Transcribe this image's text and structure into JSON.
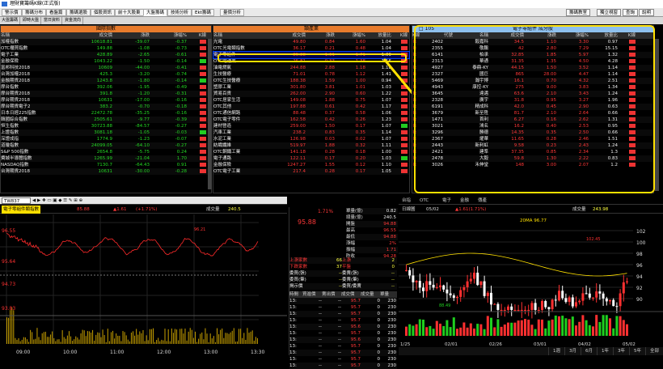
{
  "window": {
    "title": "理財寶籌碼K線(正式版)"
  },
  "tabs": [
    "警示價",
    "籌碼分布",
    "看盤篇",
    "籌碼選股",
    "個股資訊",
    "前十大股東",
    "大盤籌碼",
    "技術分析",
    "Ekt籌碼",
    "量價分析"
  ],
  "right_buttons": [
    "籌碼教室",
    "獨立視窗",
    "查詢",
    "說明"
  ],
  "subtabs": [
    "大盤籌碼",
    "即時大盤",
    "當日資料",
    "資金流向",
    "法人動向",
    "地緣分點",
    "主力進出",
    "庫存明細"
  ],
  "intl": {
    "title": "國際指數",
    "cols": [
      "名稱",
      "成交價",
      "漲跌",
      "漲幅%",
      "K線"
    ],
    "rows": [
      [
        "加權指數",
        "10618.81",
        "-39.07",
        "-0.37",
        "r"
      ],
      [
        "OTC櫃買指數",
        "149.88",
        "-1.08",
        "-0.73",
        "r"
      ],
      [
        "電子工業",
        "428.89",
        "-2.65",
        "-0.61",
        "r"
      ],
      [
        "金融保險",
        "1043.22",
        "-1.50",
        "-0.14",
        "g"
      ],
      [
        "富邦科技2018",
        "10609",
        "-44.00",
        "-0.41",
        "r"
      ],
      [
        "台灣加權2018",
        "425.3",
        "-3.20",
        "-0.74",
        "r"
      ],
      [
        "金融期貨2018",
        "1243.8",
        "-1.80",
        "-0.14",
        "g"
      ],
      [
        "摩台指數",
        "392.06",
        "-1.95",
        "-0.49",
        "r"
      ],
      [
        "摩台期貨2018",
        "391.8",
        "-1.20",
        "-0.31",
        "r"
      ],
      [
        "摩台期貨2018",
        "10631",
        "-17.00",
        "-0.16",
        "r"
      ],
      [
        "摩台期貨電子2",
        "383.2",
        "-0.70",
        "-0.18",
        "r"
      ],
      [
        "日本日經225指數",
        "22472.78",
        "-35.25",
        "-0.16",
        "r"
      ],
      [
        "韓國綜合指數",
        "2505.61",
        "-9.77",
        "-0.39",
        "r"
      ],
      [
        "恒生指數",
        "30723.88",
        "-84.57",
        "-0.27",
        "r"
      ],
      [
        "上證指數",
        "3081.18",
        "-1.05",
        "-0.03",
        "g"
      ],
      [
        "深證成指",
        "1774.9",
        "-1.23",
        "-0.07",
        "r"
      ],
      [
        "道瓊指數",
        "24099.05",
        "-64.10",
        "-0.27",
        "r"
      ],
      [
        "S&P 500指數",
        "2654.8",
        "-5.75",
        "0.24",
        "r"
      ],
      [
        "費城半導體指數",
        "1265.99",
        "-21.04",
        "1.70",
        "r"
      ],
      [
        "NASDAQ指數",
        "7130.7",
        "-64.43",
        "0.91",
        "r"
      ],
      [
        "台灣期貨2018",
        "10631",
        "-30.00",
        "-0.28",
        "r"
      ]
    ]
  },
  "sector": {
    "title": "類產業",
    "cols": [
      "名稱",
      "成交價",
      "漲跌",
      "漲幅%",
      "放量比",
      "K線"
    ],
    "rows": [
      [
        "光電",
        "49.80",
        "0.84",
        "1.60",
        "1.04",
        "r"
      ],
      [
        "OTC光電類指數",
        "36.17",
        "0.21",
        "0.48",
        "1.04",
        "r"
      ],
      [
        "電子零組件",
        "85.88",
        "1.61",
        "1.71",
        "1.09",
        "r"
      ],
      [
        "OTC電通業",
        "25.81",
        "0.33",
        "1.38",
        "1.16",
        "r"
      ],
      [
        "油電燃氣",
        "244.88",
        "2.88",
        "1.18",
        "1.18",
        "r"
      ],
      [
        "生技醫療",
        "71.01",
        "0.78",
        "1.12",
        "1.41",
        "r"
      ],
      [
        "OTC生技醫療",
        "188.38",
        "1.59",
        "1.00",
        "0.94",
        "r"
      ],
      [
        "塑膠工業",
        "301.80",
        "3.81",
        "1.01",
        "1.03",
        "r"
      ],
      [
        "貿易百貨",
        "262.00",
        "2.90",
        "0.60",
        "1.22",
        "r"
      ],
      [
        "OTC居家生活",
        "149.08",
        "1.88",
        "0.75",
        "1.07",
        "r"
      ],
      [
        "OTC其他",
        "197.88",
        "0.61",
        "0.42",
        "1.17",
        "r"
      ],
      [
        "OTC通信網路",
        "88.48",
        "0.37",
        "0.58",
        "1.06",
        "r"
      ],
      [
        "OTC電子零件",
        "162.58",
        "0.42",
        "0.26",
        "1.23",
        "r"
      ],
      [
        "建材營造",
        "259.00",
        "1.50",
        "0.17",
        "1.07",
        "g"
      ],
      [
        "汽車工業",
        "238.2",
        "0.83",
        "0.35",
        "1.14",
        "r"
      ],
      [
        "水泥工業",
        "126.98",
        "0.03",
        "0.02",
        "1.07",
        "r"
      ],
      [
        "紡織纖維",
        "519.97",
        "1.88",
        "0.32",
        "1.11",
        "r"
      ],
      [
        "OTC鋼鐵工業",
        "141.18",
        "0.28",
        "0.18",
        "1.00",
        "r"
      ],
      [
        "電子通路",
        "122.11",
        "0.17",
        "0.20",
        "1.03",
        "g"
      ],
      [
        "金融保險",
        "1247.27",
        "1.55",
        "0.12",
        "1.10",
        "r"
      ],
      [
        "OTC電子工業",
        "217.4",
        "0.28",
        "0.17",
        "1.05",
        "r"
      ]
    ]
  },
  "comp": {
    "title": "電子零組件 成分股",
    "code_label": "□ 105",
    "cols": [
      "K線",
      "代號",
      "名稱",
      "成交價",
      "漲跌",
      "漲幅%",
      "放量比",
      "K線"
    ],
    "rows": [
      [
        "2402",
        "毅嘉科",
        "34.5",
        "1.10",
        "3.30",
        "0.97"
      ],
      [
        "2355",
        "敬鵬",
        "42",
        "2.80",
        "7.29",
        "15.15"
      ],
      [
        "6141",
        "柏承",
        "32.85",
        "1.85",
        "5.97",
        "1.32"
      ],
      [
        "2313",
        "華通",
        "31.35",
        "1.35",
        "4.50",
        "4.28"
      ],
      [
        "4927",
        "泰鼎-KY",
        "44.15",
        "1.50",
        "3.52",
        "1.14"
      ],
      [
        "2327",
        "國巨",
        "865",
        "28.00",
        "4.47",
        "1.14"
      ],
      [
        "5469",
        "瀚宇博",
        "16.1",
        "0.70",
        "4.32",
        "2.51"
      ],
      [
        "4943",
        "康控-KY",
        "275",
        "9.00",
        "3.83",
        "1.34"
      ],
      [
        "3645",
        "達邁",
        "63.6",
        "2.10",
        "3.43",
        "1.24"
      ],
      [
        "2328",
        "廣宇",
        "31.8",
        "0.95",
        "3.27",
        "1.96"
      ],
      [
        "6191",
        "精成科",
        "42.0",
        "0.45",
        "2.90",
        "0.63"
      ],
      [
        "3679",
        "新至陞",
        "81.7",
        "2.10",
        "2.64",
        "0.66"
      ],
      [
        "1471",
        "首利",
        "6.27",
        "0.16",
        "2.62",
        "1.31"
      ],
      [
        "3021",
        "鴻名",
        "16.2",
        "0.40",
        "2.53",
        "0.95"
      ],
      [
        "3296",
        "勝德",
        "14.35",
        "0.35",
        "2.50",
        "0.66"
      ],
      [
        "2367",
        "燿華",
        "11.65",
        "0.28",
        "2.46",
        "1.51"
      ],
      [
        "2443",
        "新利虹",
        "9.58",
        "0.23",
        "2.43",
        "1.24"
      ],
      [
        "2421",
        "建準",
        "37.35",
        "0.85",
        "2.34",
        "1.3"
      ],
      [
        "2478",
        "大毅",
        "59.8",
        "1.30",
        "2.22",
        "0.83"
      ],
      [
        "3026",
        "禾伸堂",
        "148",
        "3.00",
        "2.07",
        "1.2"
      ]
    ]
  },
  "intraday": {
    "code": "TW837",
    "name": "電子零組件類指數",
    "price": "85.88",
    "chg": "▲1.61",
    "pct": "(+1.71%)",
    "vol_label": "成交量",
    "vol": "240.5",
    "ylabels": [
      "96.55",
      "95.64",
      "94.73",
      "93.83"
    ],
    "ylabels2": [
      "94.28",
      "93.83"
    ],
    "xlabels": [
      "09:00",
      "10:00",
      "11:00",
      "12:00",
      "13:00",
      "13:30"
    ],
    "peak": "96.21"
  },
  "quote": {
    "price": "95.88",
    "chg": "1.71%",
    "rows": [
      [
        "單量(億)",
        "0.82"
      ],
      [
        "總量(億)",
        "240.5"
      ],
      [
        "開盤",
        "94.88"
      ],
      [
        "最高",
        "96.55"
      ],
      [
        "最低",
        "94.88"
      ],
      [
        "漲幅",
        "2%"
      ],
      [
        "振幅",
        "1.71"
      ],
      [
        "昨收",
        "94.28"
      ]
    ],
    "stats": [
      [
        "上漲家數",
        "66",
        "上漲",
        "2"
      ],
      [
        "下跌家數",
        "37",
        "平盤",
        "0"
      ],
      [
        "委買(張)",
        "--",
        "委賣(張)",
        "--"
      ],
      [
        "委買(筆)",
        "--",
        "委賣(筆)",
        "--"
      ],
      [
        "揭示價",
        "--",
        "委買/委賣",
        "--"
      ]
    ],
    "tick_cols": [
      "時間",
      "買進價",
      "賣出價",
      "成交價",
      "成交量",
      "單量"
    ],
    "ticks": [
      [
        "13:",
        "--",
        "--",
        "95.7",
        "0",
        "230"
      ],
      [
        "13:",
        "--",
        "--",
        "95.7",
        "0",
        "230"
      ],
      [
        "13:",
        "--",
        "--",
        "95.7",
        "0",
        "230"
      ],
      [
        "13:",
        "--",
        "--",
        "95.7",
        "0",
        "230"
      ],
      [
        "13:",
        "--",
        "--",
        "95.6",
        "0",
        "230"
      ],
      [
        "13:",
        "--",
        "--",
        "95.7",
        "0",
        "230"
      ],
      [
        "13:",
        "--",
        "--",
        "95.6",
        "0",
        "230"
      ],
      [
        "13:",
        "--",
        "--",
        "95.7",
        "0",
        "230"
      ],
      [
        "13:",
        "--",
        "--",
        "95.7",
        "0",
        "230"
      ],
      [
        "13:",
        "--",
        "--",
        "95.7",
        "0",
        "230"
      ],
      [
        "13:",
        "--",
        "--",
        "95.7",
        "0",
        "230"
      ]
    ]
  },
  "kchart": {
    "tabs": [
      "台指",
      "OTC",
      "電子",
      "金融",
      "傳產"
    ],
    "period": "日線圖",
    "date": "05/02",
    "chg": "▲1.61(1.71%)",
    "vol_label": "成交量",
    "vol": "243.98",
    "ma": "20MA 96.77",
    "ylabels": [
      "102",
      "100",
      "98",
      "96",
      "94",
      "92",
      "90"
    ],
    "xlabels": [
      "1/25",
      "02/01",
      "02/26",
      "03/01",
      "04/02",
      "05/02"
    ],
    "hi": "102.45",
    "lo": "88.49",
    "periods": [
      "1週",
      "3月",
      "6月",
      "1年",
      "3年",
      "5年",
      "全部"
    ]
  },
  "scale": {
    "label": "明細"
  }
}
